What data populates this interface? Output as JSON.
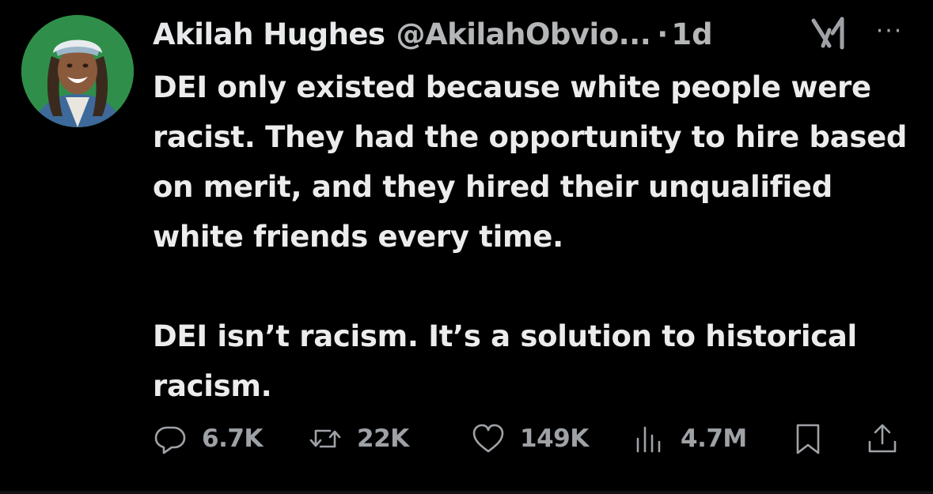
{
  "tweet": {
    "author_name": "Akilah Hughes",
    "handle": "@AkilahObvio...",
    "separator": "·",
    "time": "1d",
    "body_paragraph_1": "DEI only existed because white people were racist. They had the opportunity to hire based on merit, and they hired their unqualified white friends every time.",
    "body_paragraph_2": "DEI isn’t racism. It’s a solution to historical racism.",
    "more_label": "···"
  },
  "actions": {
    "replies": "6.7K",
    "reposts": "22K",
    "likes": "149K",
    "views": "4.7M"
  },
  "icons": {
    "reply": "reply-icon",
    "repost": "repost-icon",
    "like": "heart-icon",
    "views": "views-chart-icon",
    "bookmark": "bookmark-icon",
    "share": "share-icon",
    "grok": "grok-icon",
    "more": "more-icon"
  },
  "colors": {
    "background": "#000000",
    "text_primary": "#e7e9ea",
    "text_secondary": "#9ea2a6",
    "avatar_bg": "#2f8f4a"
  }
}
